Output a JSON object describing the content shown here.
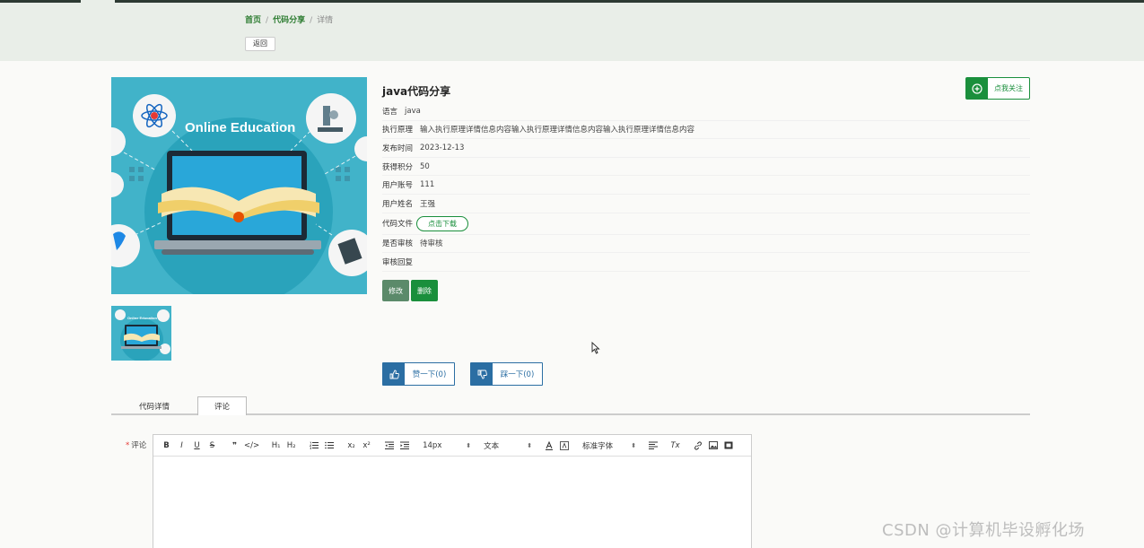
{
  "breadcrumb": {
    "home": "首页",
    "section": "代码分享",
    "current": "详情",
    "sep": "/"
  },
  "back_label": "返回",
  "image": {
    "banner_text": "Online Education",
    "thumb_text": "Online Education"
  },
  "detail": {
    "title": "java代码分享",
    "follow_label": "点我关注",
    "fields": [
      {
        "key": "语言",
        "value": "java"
      },
      {
        "key": "执行原理",
        "value": "输入执行原理详情信息内容输入执行原理详情信息内容输入执行原理详情信息内容"
      },
      {
        "key": "发布时间",
        "value": "2023-12-13"
      },
      {
        "key": "获得积分",
        "value": "50"
      },
      {
        "key": "用户账号",
        "value": "111"
      },
      {
        "key": "用户姓名",
        "value": "王强"
      }
    ],
    "file_key": "代码文件",
    "download_label": "点击下载",
    "audit_key": "是否审核",
    "audit_value": "待审核",
    "reply_key": "审核回复",
    "reply_value": "",
    "edit_label": "修改",
    "delete_label": "删除",
    "like_label": "赞一下(0)",
    "dislike_label": "踩一下(0)"
  },
  "tabs": [
    "代码详情",
    "评论"
  ],
  "comment": {
    "required_mark": "*",
    "label": "评论",
    "toolbar": {
      "bold": "B",
      "italic": "I",
      "underline": "U",
      "strike": "S",
      "quote": "❞",
      "code": "</>",
      "h1": "H₁",
      "h2": "H₂",
      "sub": "x₂",
      "sup": "x²",
      "size": "14px",
      "header": "文本",
      "font": "标准字体",
      "clean": "Tx"
    }
  },
  "watermark": "CSDN @计算机毕设孵化场",
  "colors": {
    "green": "#1a8f3c",
    "blue": "#2b6ea3",
    "header_bg": "#e9eee8",
    "edit_green": "#5b8a6a"
  }
}
